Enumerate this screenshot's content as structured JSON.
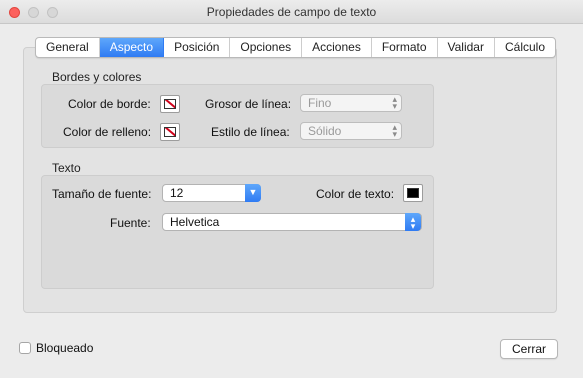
{
  "window": {
    "title": "Propiedades de campo de texto"
  },
  "tabs": [
    {
      "label": "General",
      "active": false
    },
    {
      "label": "Aspecto",
      "active": true
    },
    {
      "label": "Posición",
      "active": false
    },
    {
      "label": "Opciones",
      "active": false
    },
    {
      "label": "Acciones",
      "active": false
    },
    {
      "label": "Formato",
      "active": false
    },
    {
      "label": "Validar",
      "active": false
    },
    {
      "label": "Cálculo",
      "active": false
    }
  ],
  "borders": {
    "section_label": "Bordes y colores",
    "border_color_label": "Color de borde:",
    "fill_color_label": "Color de relleno:",
    "line_width_label": "Grosor de línea:",
    "line_width_value": "Fino",
    "line_style_label": "Estilo de línea:",
    "line_style_value": "Sólido"
  },
  "text": {
    "section_label": "Texto",
    "font_size_label": "Tamaño de fuente:",
    "font_size_value": "12",
    "text_color_label": "Color de texto:",
    "text_color": "#000000",
    "font_label": "Fuente:",
    "font_value": "Helvetica"
  },
  "footer": {
    "locked_label": "Bloqueado",
    "locked": false,
    "close_label": "Cerrar"
  },
  "colors": {
    "accent": "#2f7bf3",
    "no_color_slash": "#d0021b"
  }
}
